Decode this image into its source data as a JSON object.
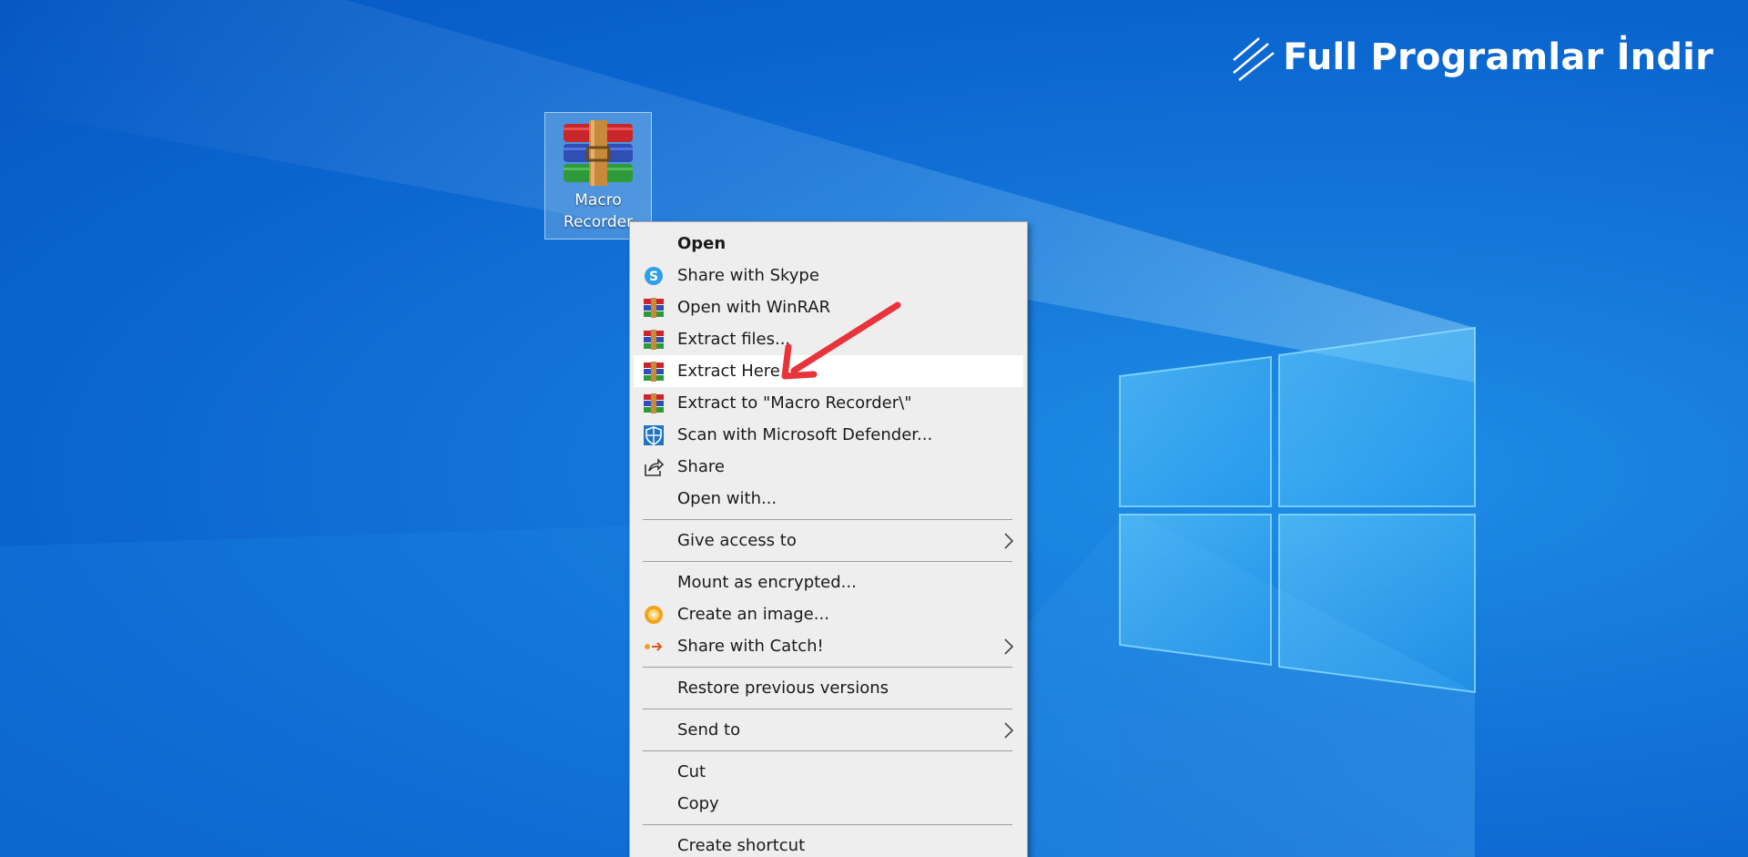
{
  "watermark": {
    "text": "Full Programlar İndir",
    "icon": "slash-lines-icon"
  },
  "desktop_icon": {
    "label": "Macro\nRecorder",
    "icon": "winrar-archive-icon"
  },
  "colors": {
    "desktop_bg": "#1577d9",
    "menu_bg": "#eeeeee",
    "highlight": "#ffffff",
    "arrow": "#e8333a"
  },
  "context_menu": {
    "items": [
      {
        "label": "Open",
        "icon": "",
        "bold": true
      },
      {
        "label": "Share with Skype",
        "icon": "skype-icon"
      },
      {
        "label": "Open with WinRAR",
        "icon": "winrar-icon"
      },
      {
        "label": "Extract files...",
        "icon": "winrar-icon"
      },
      {
        "label": "Extract Here",
        "icon": "winrar-icon",
        "highlighted": true
      },
      {
        "label": "Extract to \"Macro Recorder\\\"",
        "icon": "winrar-icon"
      },
      {
        "label": "Scan with Microsoft Defender...",
        "icon": "defender-shield-icon"
      },
      {
        "label": "Share",
        "icon": "share-icon"
      },
      {
        "label": "Open with...",
        "icon": ""
      },
      {
        "label": "Give access to",
        "icon": "",
        "submenu": true
      },
      {
        "label": "Mount as encrypted...",
        "icon": ""
      },
      {
        "label": "Create an image...",
        "icon": "disc-icon"
      },
      {
        "label": "Share with Catch!",
        "icon": "catch-icon",
        "submenu": true
      },
      {
        "label": "Restore previous versions",
        "icon": ""
      },
      {
        "label": "Send to",
        "icon": "",
        "submenu": true
      },
      {
        "label": "Cut",
        "icon": ""
      },
      {
        "label": "Copy",
        "icon": ""
      },
      {
        "label": "Create shortcut",
        "icon": ""
      }
    ]
  }
}
